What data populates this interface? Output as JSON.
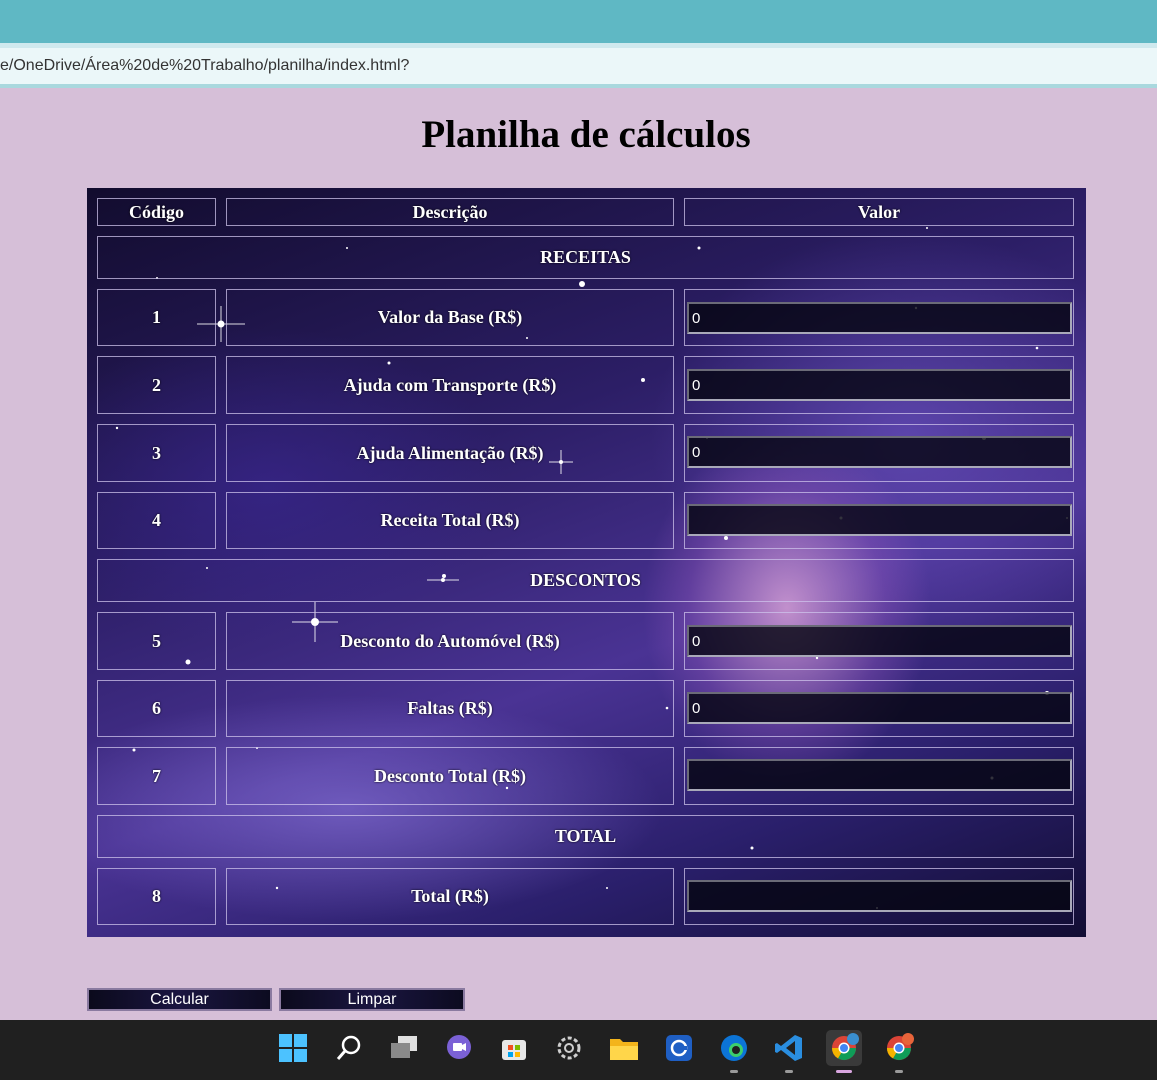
{
  "browser": {
    "address": "e/OneDrive/Área%20de%20Trabalho/planilha/index.html?"
  },
  "page": {
    "title": "Planilha de cálculos"
  },
  "table": {
    "headers": {
      "code": "Código",
      "description": "Descrição",
      "value": "Valor"
    },
    "sections": {
      "receitas": "RECEITAS",
      "descontos": "DESCONTOS",
      "total": "TOTAL"
    },
    "rows": [
      {
        "code": "1",
        "description": "Valor da Base (R$)",
        "value": "0"
      },
      {
        "code": "2",
        "description": "Ajuda com Transporte (R$)",
        "value": "0"
      },
      {
        "code": "3",
        "description": "Ajuda Alimentação (R$)",
        "value": "0"
      },
      {
        "code": "4",
        "description": "Receita Total (R$)",
        "value": ""
      },
      {
        "code": "5",
        "description": "Desconto do Automóvel (R$)",
        "value": "0"
      },
      {
        "code": "6",
        "description": "Faltas (R$)",
        "value": "0"
      },
      {
        "code": "7",
        "description": "Desconto Total (R$)",
        "value": ""
      },
      {
        "code": "8",
        "description": "Total (R$)",
        "value": ""
      }
    ]
  },
  "buttons": {
    "calculate": "Calcular",
    "clear": "Limpar"
  },
  "taskbar": {
    "icons": [
      "windows-start-icon",
      "search-icon",
      "task-view-icon",
      "chat-icon",
      "store-icon",
      "settings-icon",
      "file-explorer-icon",
      "copilot-icon",
      "edge-icon",
      "vscode-icon",
      "chrome-profile-icon",
      "chrome-icon"
    ]
  }
}
